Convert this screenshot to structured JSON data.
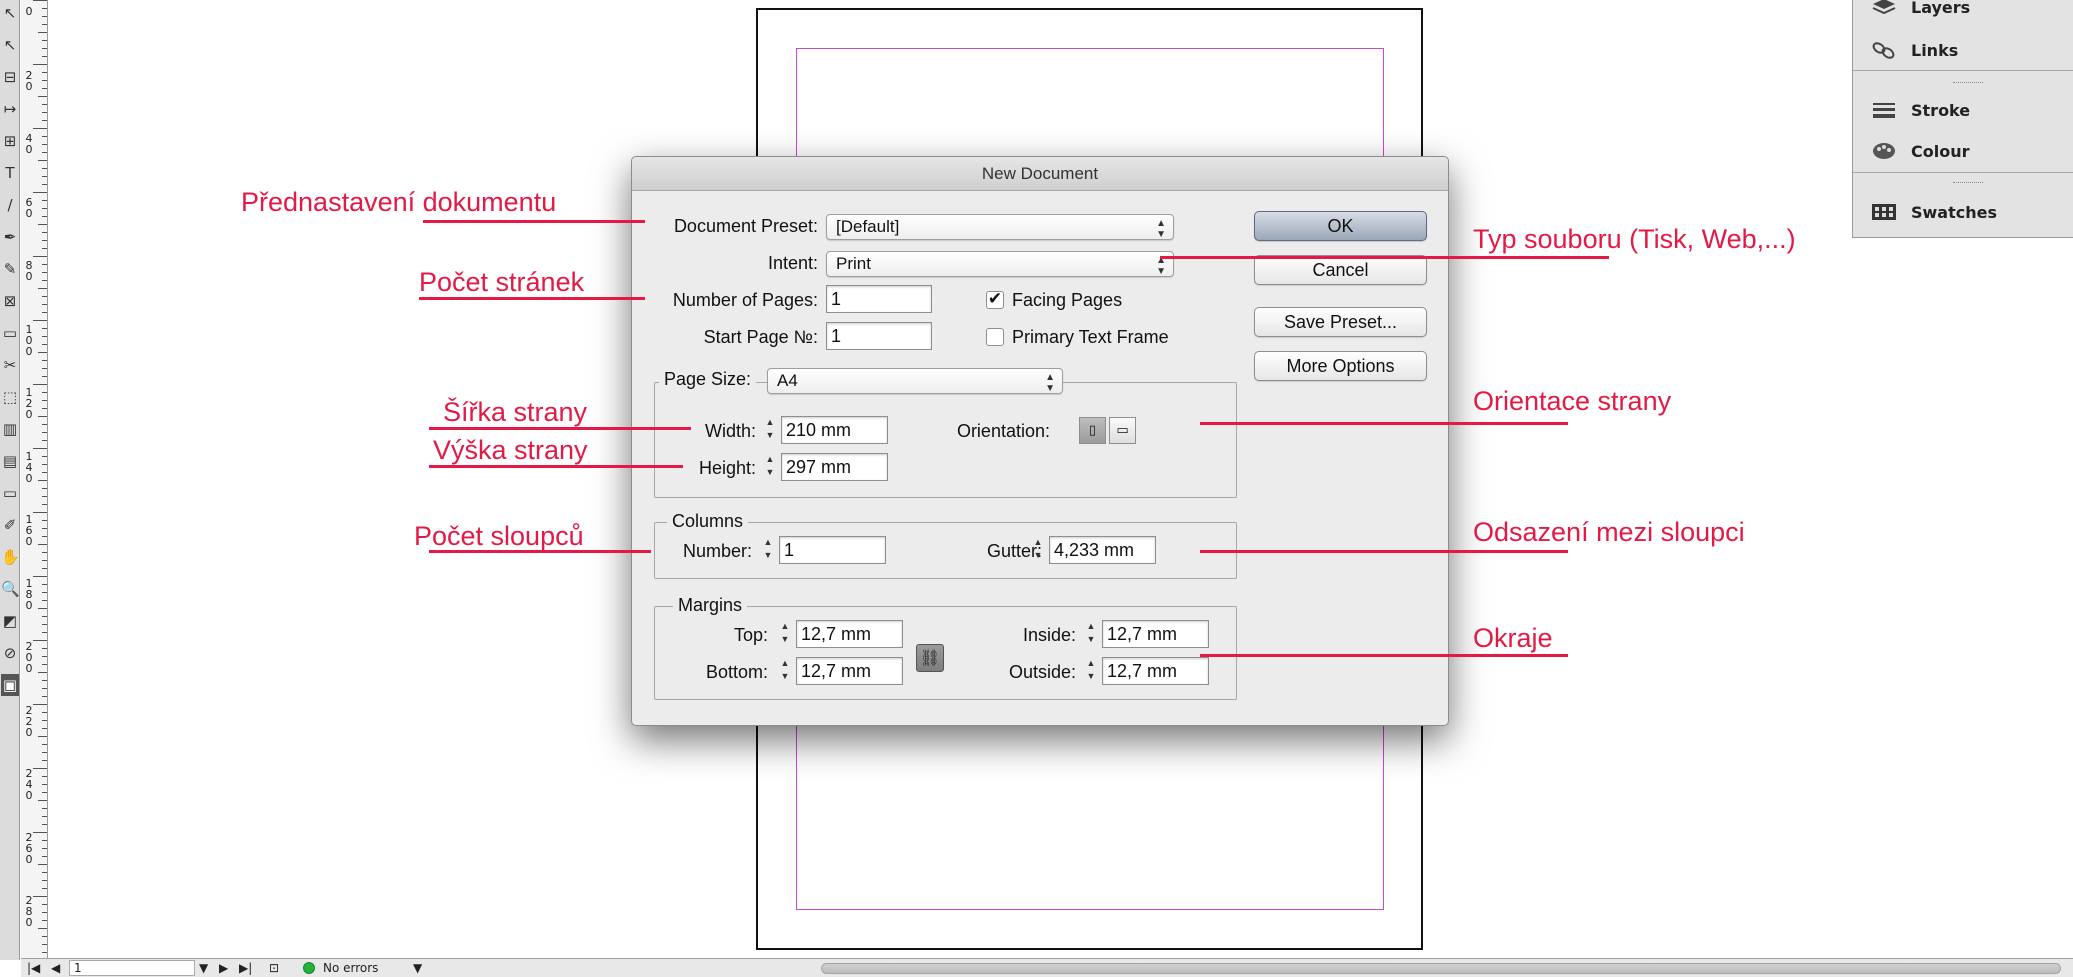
{
  "toolbar": {
    "tools": [
      "selection-tool",
      "direct-selection-tool",
      "page-tool",
      "gap-tool",
      "content-collector-tool",
      "type-tool",
      "line-tool",
      "pen-tool",
      "pencil-tool",
      "rectangle-frame-tool",
      "rectangle-tool",
      "scissors-tool",
      "free-transform-tool",
      "gradient-swatch-tool",
      "gradient-feather-tool",
      "note-tool",
      "eyedropper-tool",
      "hand-tool",
      "zoom-tool",
      "fill-stroke-swatch",
      "apply-none",
      "screen-mode"
    ],
    "tool_glyphs": [
      "↖",
      "↖",
      "⊟",
      "↦",
      "⊞",
      "T",
      "/",
      "✒",
      "✎",
      "⊠",
      "▭",
      "✂",
      "⬚",
      "▥",
      "▤",
      "▭",
      "✐",
      "✋",
      "🔍",
      "◩",
      "⊘",
      "▣"
    ]
  },
  "ruler": {
    "labels": [
      "0",
      "20",
      "40",
      "60",
      "80",
      "100",
      "120",
      "140",
      "160",
      "180",
      "200",
      "220",
      "240",
      "260",
      "280"
    ]
  },
  "panel": {
    "items": [
      {
        "label": "Layers",
        "icon": "layers-icon"
      },
      {
        "label": "Links",
        "icon": "links-icon"
      },
      {
        "label": "Stroke",
        "icon": "stroke-icon"
      },
      {
        "label": "Colour",
        "icon": "colour-icon"
      },
      {
        "label": "Swatches",
        "icon": "swatches-icon"
      }
    ]
  },
  "dialog": {
    "title": "New Document",
    "document_preset": {
      "label": "Document Preset:",
      "value": "[Default]"
    },
    "intent": {
      "label": "Intent:",
      "value": "Print"
    },
    "number_of_pages": {
      "label": "Number of Pages:",
      "value": "1"
    },
    "start_page": {
      "label": "Start Page №:",
      "value": "1"
    },
    "facing_pages": {
      "label": "Facing Pages",
      "checked": true
    },
    "primary_text_frame": {
      "label": "Primary Text Frame",
      "checked": false
    },
    "page_size": {
      "label": "Page Size:",
      "value": "A4"
    },
    "width": {
      "label": "Width:",
      "value": "210 mm"
    },
    "height": {
      "label": "Height:",
      "value": "297 mm"
    },
    "orientation": {
      "label": "Orientation:",
      "selected": "portrait"
    },
    "columns": {
      "title": "Columns",
      "number_label": "Number:",
      "number_value": "1",
      "gutter_label": "Gutter:",
      "gutter_value": "4,233 mm"
    },
    "margins": {
      "title": "Margins",
      "top_label": "Top:",
      "top_value": "12,7 mm",
      "bottom_label": "Bottom:",
      "bottom_value": "12,7 mm",
      "inside_label": "Inside:",
      "inside_value": "12,7 mm",
      "outside_label": "Outside:",
      "outside_value": "12,7 mm"
    },
    "buttons": {
      "ok": "OK",
      "cancel": "Cancel",
      "save_preset": "Save Preset...",
      "more_options": "More Options"
    }
  },
  "annotations": {
    "preset": "Přednastavení dokumentu",
    "pages": "Počet stránek",
    "width": "Šířka strany",
    "height": "Výška strany",
    "columns": "Počet sloupců",
    "intent": "Typ souboru (Tisk, Web,...)",
    "orientation": "Orientace strany",
    "gutter": "Odsazení mezi sloupci",
    "margins": "Okraje"
  },
  "statusbar": {
    "page_number": "1",
    "errors": "No errors"
  },
  "colors": {
    "annotation": "#e21a45",
    "margin_guide": "#c64ccf",
    "status_ok": "#23b33a"
  }
}
